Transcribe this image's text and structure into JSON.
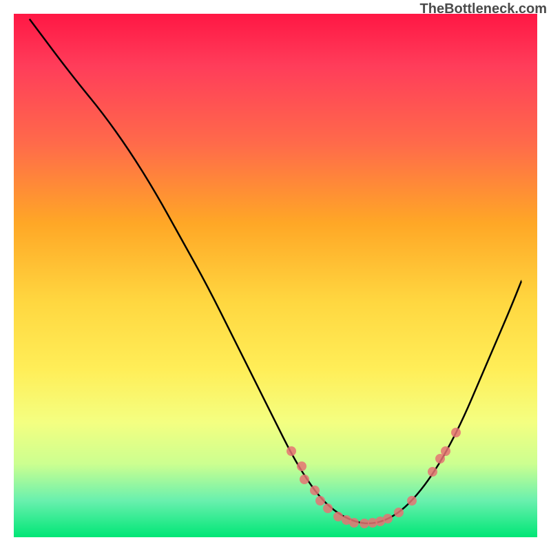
{
  "watermark": "TheBottleneck.com",
  "chart_data": {
    "type": "line",
    "title": "",
    "xlabel": "",
    "ylabel": "",
    "xlim": [
      0,
      100
    ],
    "ylim": [
      0,
      100
    ],
    "curve": [
      {
        "x": 3.0,
        "y": 99.0
      },
      {
        "x": 6.0,
        "y": 95.0
      },
      {
        "x": 9.0,
        "y": 91.0
      },
      {
        "x": 12.5,
        "y": 86.5
      },
      {
        "x": 17.0,
        "y": 81.0
      },
      {
        "x": 22.0,
        "y": 74.0
      },
      {
        "x": 27.0,
        "y": 66.0
      },
      {
        "x": 32.0,
        "y": 57.0
      },
      {
        "x": 37.0,
        "y": 48.0
      },
      {
        "x": 42.0,
        "y": 38.0
      },
      {
        "x": 46.0,
        "y": 30.0
      },
      {
        "x": 50.0,
        "y": 22.0
      },
      {
        "x": 53.0,
        "y": 16.0
      },
      {
        "x": 56.0,
        "y": 11.0
      },
      {
        "x": 59.0,
        "y": 7.0
      },
      {
        "x": 62.0,
        "y": 4.5
      },
      {
        "x": 65.0,
        "y": 3.0
      },
      {
        "x": 68.0,
        "y": 2.5
      },
      {
        "x": 71.0,
        "y": 3.2
      },
      {
        "x": 74.0,
        "y": 5.0
      },
      {
        "x": 77.0,
        "y": 8.0
      },
      {
        "x": 80.0,
        "y": 12.0
      },
      {
        "x": 83.0,
        "y": 17.0
      },
      {
        "x": 86.0,
        "y": 23.0
      },
      {
        "x": 89.0,
        "y": 30.0
      },
      {
        "x": 92.0,
        "y": 37.0
      },
      {
        "x": 95.0,
        "y": 44.0
      },
      {
        "x": 97.0,
        "y": 49.0
      }
    ],
    "scatter": [
      {
        "x": 53.0,
        "y": 16.5
      },
      {
        "x": 55.0,
        "y": 13.5
      },
      {
        "x": 55.5,
        "y": 11.0
      },
      {
        "x": 57.5,
        "y": 9.0
      },
      {
        "x": 58.5,
        "y": 7.0
      },
      {
        "x": 60.0,
        "y": 5.5
      },
      {
        "x": 62.0,
        "y": 4.0
      },
      {
        "x": 63.5,
        "y": 3.3
      },
      {
        "x": 65.0,
        "y": 2.8
      },
      {
        "x": 67.0,
        "y": 2.6
      },
      {
        "x": 68.5,
        "y": 2.8
      },
      {
        "x": 70.0,
        "y": 3.0
      },
      {
        "x": 71.5,
        "y": 3.5
      },
      {
        "x": 73.5,
        "y": 4.8
      },
      {
        "x": 76.0,
        "y": 7.0
      },
      {
        "x": 80.0,
        "y": 12.5
      },
      {
        "x": 81.5,
        "y": 15.0
      },
      {
        "x": 82.5,
        "y": 16.5
      },
      {
        "x": 84.5,
        "y": 20.0
      }
    ]
  }
}
